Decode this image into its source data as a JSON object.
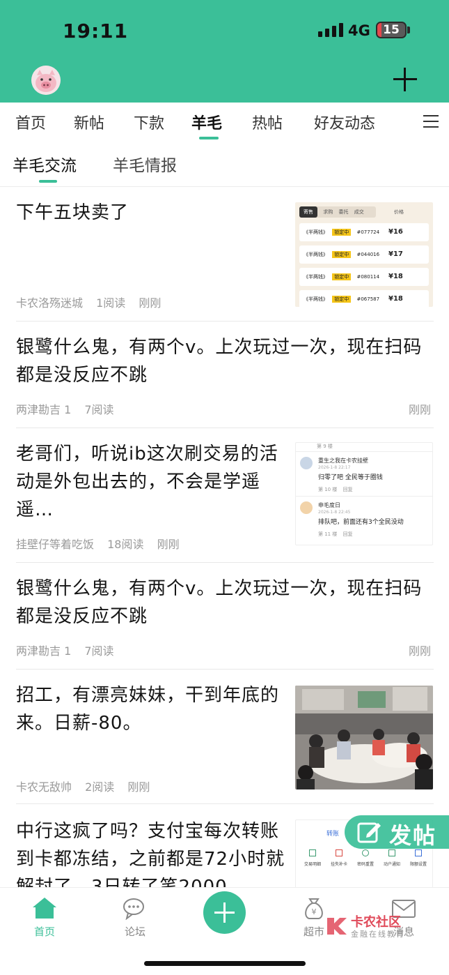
{
  "status_bar": {
    "time": "19:11",
    "network": "4G",
    "battery": "15",
    "battery_level": 0.15
  },
  "colors": {
    "brand": "#3bbf98",
    "battery_low": "#e5484d"
  },
  "top_tabs": [
    "首页",
    "新帖",
    "下款",
    "羊毛",
    "热帖",
    "好友动态"
  ],
  "active_top_tab": "羊毛",
  "sub_tabs": [
    "羊毛交流",
    "羊毛情报"
  ],
  "active_sub_tab": "羊毛交流",
  "posts": [
    {
      "title": "下午五块卖了",
      "author": "卡农洛殇迷城",
      "reads": "1阅读",
      "time": "刚刚",
      "has_image": true
    },
    {
      "title": "银鹭什么鬼，有两个v。上次玩过一次，现在扫码都是没反应不跳",
      "author": "两津勘吉 1",
      "reads": "7阅读",
      "time": "刚刚",
      "has_image": false
    },
    {
      "title": "老哥们，听说ib这次刷交易的活动是外包出去的，不会是学遥遥…",
      "author": "挂壁仔等着吃饭",
      "reads": "18阅读",
      "time": "刚刚",
      "has_image": true
    },
    {
      "title": "银鹭什么鬼，有两个v。上次玩过一次，现在扫码都是没反应不跳",
      "author": "两津勘吉 1",
      "reads": "7阅读",
      "time": "刚刚",
      "has_image": false
    },
    {
      "title": "招工，有漂亮妹妹，干到年底的来。日薪-80。",
      "author": "卡农无敌帅",
      "reads": "2阅读",
      "time": "刚刚",
      "has_image": true
    },
    {
      "title": "中行这疯了吗？支付宝每次转账到卡都冻结，之前都是72小时就解封了，3日转了笔2000",
      "has_image": true
    }
  ],
  "thumb1": {
    "tabs": [
      "寄售",
      "求购",
      "委托",
      "成交"
    ],
    "sort": "价格",
    "rows": [
      {
        "name": "《半两钱》",
        "tag": "锁定中",
        "code": "#077724",
        "price": "¥16"
      },
      {
        "name": "《半两钱》",
        "tag": "锁定中",
        "code": "#044016",
        "price": "¥17"
      },
      {
        "name": "《半两钱》",
        "tag": "锁定中",
        "code": "#080114",
        "price": "¥18"
      },
      {
        "name": "《半两钱》",
        "tag": "锁定中",
        "code": "#067587",
        "price": "¥18"
      }
    ]
  },
  "thumb3": {
    "top": "第 9 楼",
    "c1": {
      "name": "重生之我在卡农挂壁",
      "date": "2026-1-8 22:17",
      "text": "归零了吧 全民等于圈钱",
      "floor": "第 10 楼",
      "reply": "回复"
    },
    "c2": {
      "name": "申毛度日",
      "date": "2026-1-8 22:45",
      "text": "排队吧，前面还有3个全民没动",
      "floor": "第 11 楼",
      "reply": "回复"
    }
  },
  "thumb6": {
    "label": "转账",
    "icons": [
      "交易明细",
      "挂失补卡",
      "密码重置",
      "动户通知",
      "限额设置"
    ]
  },
  "fab_label": "发帖",
  "bottom_nav": [
    "首页",
    "论坛",
    "超市",
    "消息"
  ],
  "active_bottom": "首页",
  "watermark": {
    "title": "卡农社区",
    "subtitle": "金融在线教育"
  }
}
